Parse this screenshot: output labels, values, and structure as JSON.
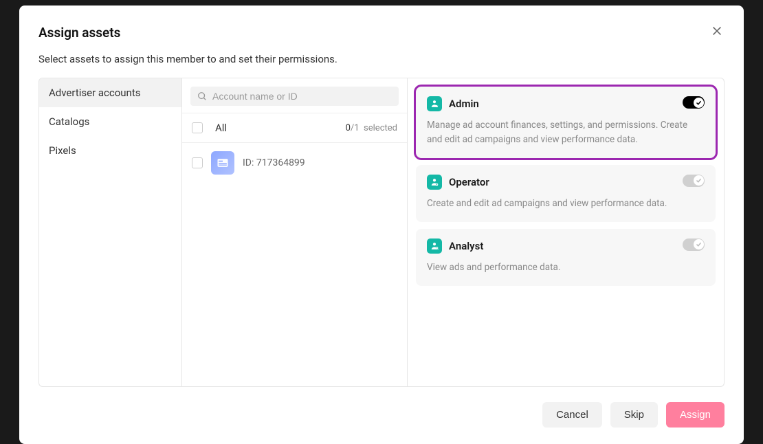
{
  "modal": {
    "title": "Assign assets",
    "subtitle": "Select assets to assign this member to and set their permissions."
  },
  "sidebar": {
    "items": [
      {
        "label": "Advertiser accounts",
        "active": true
      },
      {
        "label": "Catalogs",
        "active": false
      },
      {
        "label": "Pixels",
        "active": false
      }
    ]
  },
  "search": {
    "placeholder": "Account name or ID"
  },
  "assets": {
    "all_label": "All",
    "selected_count": "0",
    "total_count": "/1",
    "selected_word": "selected",
    "rows": [
      {
        "id_label": "ID: 717364899"
      }
    ]
  },
  "permissions": [
    {
      "title": "Admin",
      "description": "Manage ad account finances, settings, and permissions. Create and edit ad campaigns and view performance data.",
      "on": true,
      "highlighted": true
    },
    {
      "title": "Operator",
      "description": "Create and edit ad campaigns and view performance data.",
      "on": false,
      "highlighted": false
    },
    {
      "title": "Analyst",
      "description": "View ads and performance data.",
      "on": false,
      "highlighted": false
    }
  ],
  "footer": {
    "cancel": "Cancel",
    "skip": "Skip",
    "assign": "Assign"
  }
}
